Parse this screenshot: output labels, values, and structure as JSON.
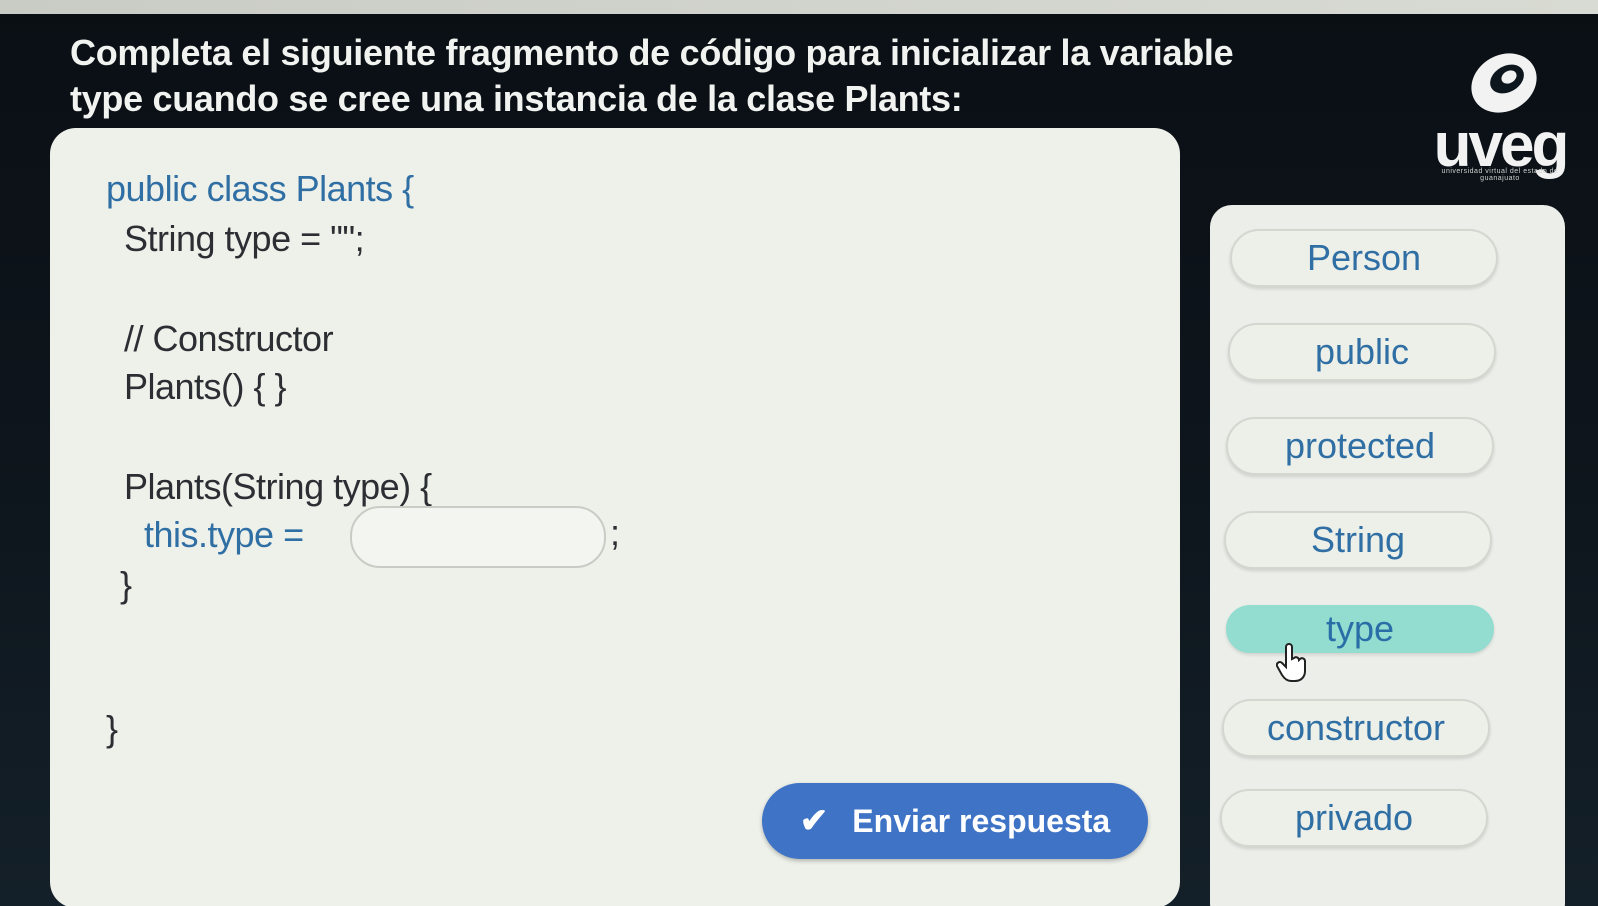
{
  "question": {
    "line1": "Completa el siguiente fragmento de código para inicializar la variable",
    "line2": "type cuando se cree una instancia de la clase Plants:"
  },
  "logo": {
    "text": "uveg",
    "subtext": "universidad virtual del estado de guanajuato"
  },
  "code": {
    "line1": "public class Plants {",
    "line2": "String type = \"\";",
    "line3": "// Constructor",
    "line4": "Plants() { }",
    "line5": "Plants(String type) {",
    "line6": "this.type =",
    "semicolon": ";",
    "line7": "}",
    "line8": "}"
  },
  "submit": {
    "label": "Enviar respuesta",
    "icon": "check-icon"
  },
  "options": [
    {
      "label": "Person",
      "selected": false
    },
    {
      "label": "public",
      "selected": false
    },
    {
      "label": "protected",
      "selected": false
    },
    {
      "label": "String",
      "selected": false
    },
    {
      "label": "type",
      "selected": true
    },
    {
      "label": "constructor",
      "selected": false
    },
    {
      "label": "privado",
      "selected": false
    }
  ],
  "colors": {
    "accent_blue": "#3e73c5",
    "selected_option": "#92dcd0",
    "code_keyword": "#2f6fa4"
  }
}
